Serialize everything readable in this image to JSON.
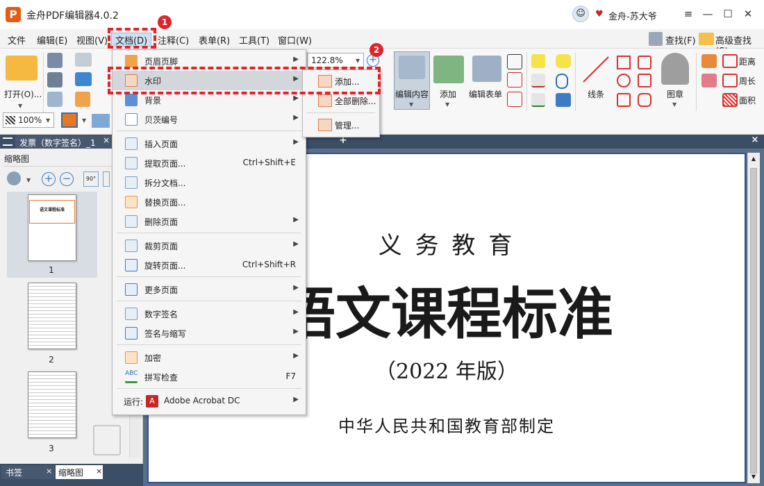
{
  "app": {
    "title": "金舟PDF编辑器4.0.2",
    "logo_text": "P",
    "user": "金舟-苏大爷",
    "window_controls": [
      "≡",
      "—",
      "☐",
      "✕"
    ]
  },
  "menubar": {
    "items": [
      "文件",
      "编辑(E)",
      "视图(V)",
      "文档(D)",
      "注释(C)",
      "表单(R)",
      "工具(T)",
      "窗口(W)"
    ],
    "find": "查找(F)",
    "advanced_find": "高级查找(S)"
  },
  "toolbar": {
    "open": "打开(O)...",
    "zoom_percent": "122.8%",
    "zoom_value": "100%",
    "edit_content": "编辑内容",
    "add": "添加",
    "edit_form": "编辑表单",
    "line": "线条",
    "stamp": "图章",
    "distance": "距离",
    "perimeter": "周长",
    "area": "面积"
  },
  "tabs": {
    "document_tab": "发票（数字签名）_1",
    "close": "×",
    "add": "+"
  },
  "left_panel": {
    "title": "缩略图",
    "pages": [
      "1",
      "2",
      "3"
    ],
    "bottom_tabs": [
      "书签",
      "缩略图"
    ]
  },
  "document": {
    "line1": "义 务 教 育",
    "line2": "语文课程标准",
    "line3": "（2022 年版）",
    "line4": "中华人民共和国教育部制定",
    "thumb_title": "语文课程标准"
  },
  "doc_menu": {
    "items": [
      {
        "label": "页眉页脚",
        "shortcut": "",
        "submenu": true
      },
      {
        "label": "水印",
        "shortcut": "",
        "submenu": true
      },
      {
        "label": "背景",
        "shortcut": "",
        "submenu": true
      },
      {
        "label": "贝茨编号",
        "shortcut": "",
        "submenu": true
      },
      {
        "label": "插入页面",
        "shortcut": "",
        "submenu": true
      },
      {
        "label": "提取页面...",
        "shortcut": "Ctrl+Shift+E",
        "submenu": false
      },
      {
        "label": "拆分文档...",
        "shortcut": "",
        "submenu": false
      },
      {
        "label": "替换页面...",
        "shortcut": "",
        "submenu": false
      },
      {
        "label": "删除页面",
        "shortcut": "",
        "submenu": true
      },
      {
        "label": "裁剪页面",
        "shortcut": "",
        "submenu": true
      },
      {
        "label": "旋转页面...",
        "shortcut": "Ctrl+Shift+R",
        "submenu": false
      },
      {
        "label": "更多页面",
        "shortcut": "",
        "submenu": true
      },
      {
        "label": "数字签名",
        "shortcut": "",
        "submenu": true
      },
      {
        "label": "签名与缩写",
        "shortcut": "",
        "submenu": true
      },
      {
        "label": "加密",
        "shortcut": "",
        "submenu": true
      },
      {
        "label": "拼写检查",
        "shortcut": "F7",
        "submenu": false
      }
    ],
    "run_label": "运行:",
    "run_app": "Adobe Acrobat DC",
    "spell_icon_text": "ABC"
  },
  "watermark_submenu": {
    "items": [
      "添加...",
      "全部删除...",
      "管理..."
    ]
  },
  "annotations": {
    "badge1": "1",
    "badge2": "2"
  },
  "colors": {
    "accent": "#e0242c",
    "tab_bg": "#3c4d66",
    "viewer_bg": "#5a6f8c",
    "menu_highlight": "#cfe0f3"
  }
}
